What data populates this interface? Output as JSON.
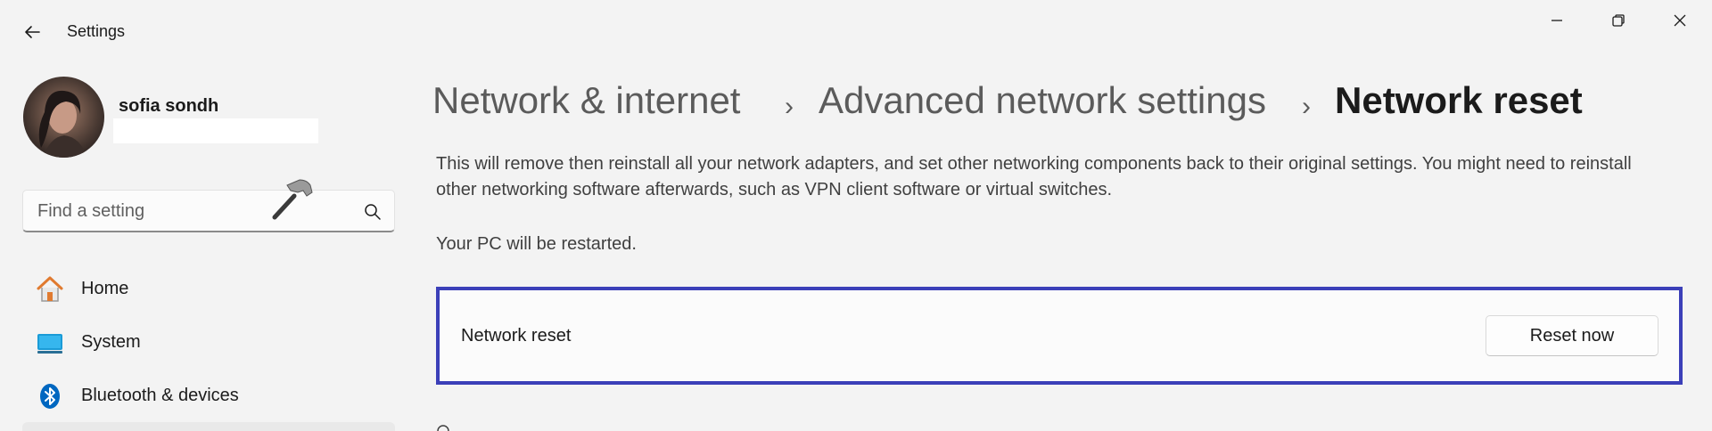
{
  "app": {
    "title": "Settings"
  },
  "user": {
    "name": "sofia sondh",
    "email": ""
  },
  "search": {
    "placeholder": "Find a setting"
  },
  "nav": {
    "items": [
      {
        "label": "Home",
        "icon": "home-icon"
      },
      {
        "label": "System",
        "icon": "system-icon"
      },
      {
        "label": "Bluetooth & devices",
        "icon": "bluetooth-icon"
      }
    ]
  },
  "breadcrumb": {
    "items": [
      "Network & internet",
      "Advanced network settings",
      "Network reset"
    ],
    "separator": "›"
  },
  "main": {
    "description": "This will remove then reinstall all your network adapters, and set other networking components back to their original settings. You might need to reinstall other networking software afterwards, such as VPN client software or virtual switches.",
    "restart_note": "Your PC will be restarted.",
    "card": {
      "label": "Network reset",
      "button_label": "Reset now"
    }
  },
  "colors": {
    "highlight_border": "#3b3fb8",
    "bluetooth": "#0067c0",
    "home_roof": "#e07a2f"
  }
}
